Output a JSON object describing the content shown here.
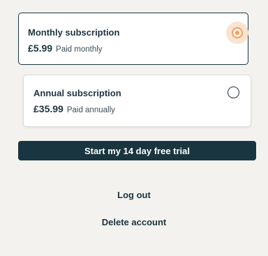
{
  "plans": [
    {
      "title": "Monthly subscription",
      "price": "£5.99",
      "period": "Paid monthly",
      "selected": true
    },
    {
      "title": "Annual subscription",
      "price": "£35.99",
      "period": "Paid annually",
      "selected": false
    }
  ],
  "actions": {
    "start_trial_label": "Start my 14 day free trial",
    "logout_label": "Log out",
    "delete_account_label": "Delete account"
  },
  "colors": {
    "page_background": "#f3f2ee",
    "primary_dark": "#183540",
    "accent_orange": "#f49d5a",
    "accent_orange_halo": "#fbe3d0"
  }
}
